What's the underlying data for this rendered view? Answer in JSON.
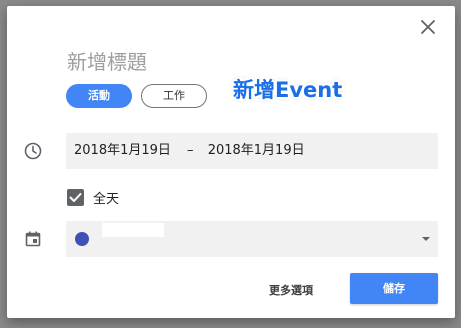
{
  "dialog": {
    "title_placeholder": "新增標題",
    "overlay_label": "新增Event",
    "tabs": [
      {
        "label": "活動",
        "active": true
      },
      {
        "label": "工作",
        "active": false
      }
    ],
    "date": {
      "start": "2018年1月19日",
      "separator": "–",
      "end": "2018年1月19日",
      "icon": "clock-icon"
    },
    "all_day": {
      "label": "全天",
      "checked": true
    },
    "calendar": {
      "icon": "calendar-icon",
      "color": "#3f51b5",
      "name": ""
    },
    "actions": {
      "more_options": "更多選項",
      "save": "儲存"
    },
    "close_icon": "close-icon"
  },
  "colors": {
    "accent": "#4285f4",
    "calendar": "#3f51b5",
    "backdrop": "#8a8a8a"
  }
}
